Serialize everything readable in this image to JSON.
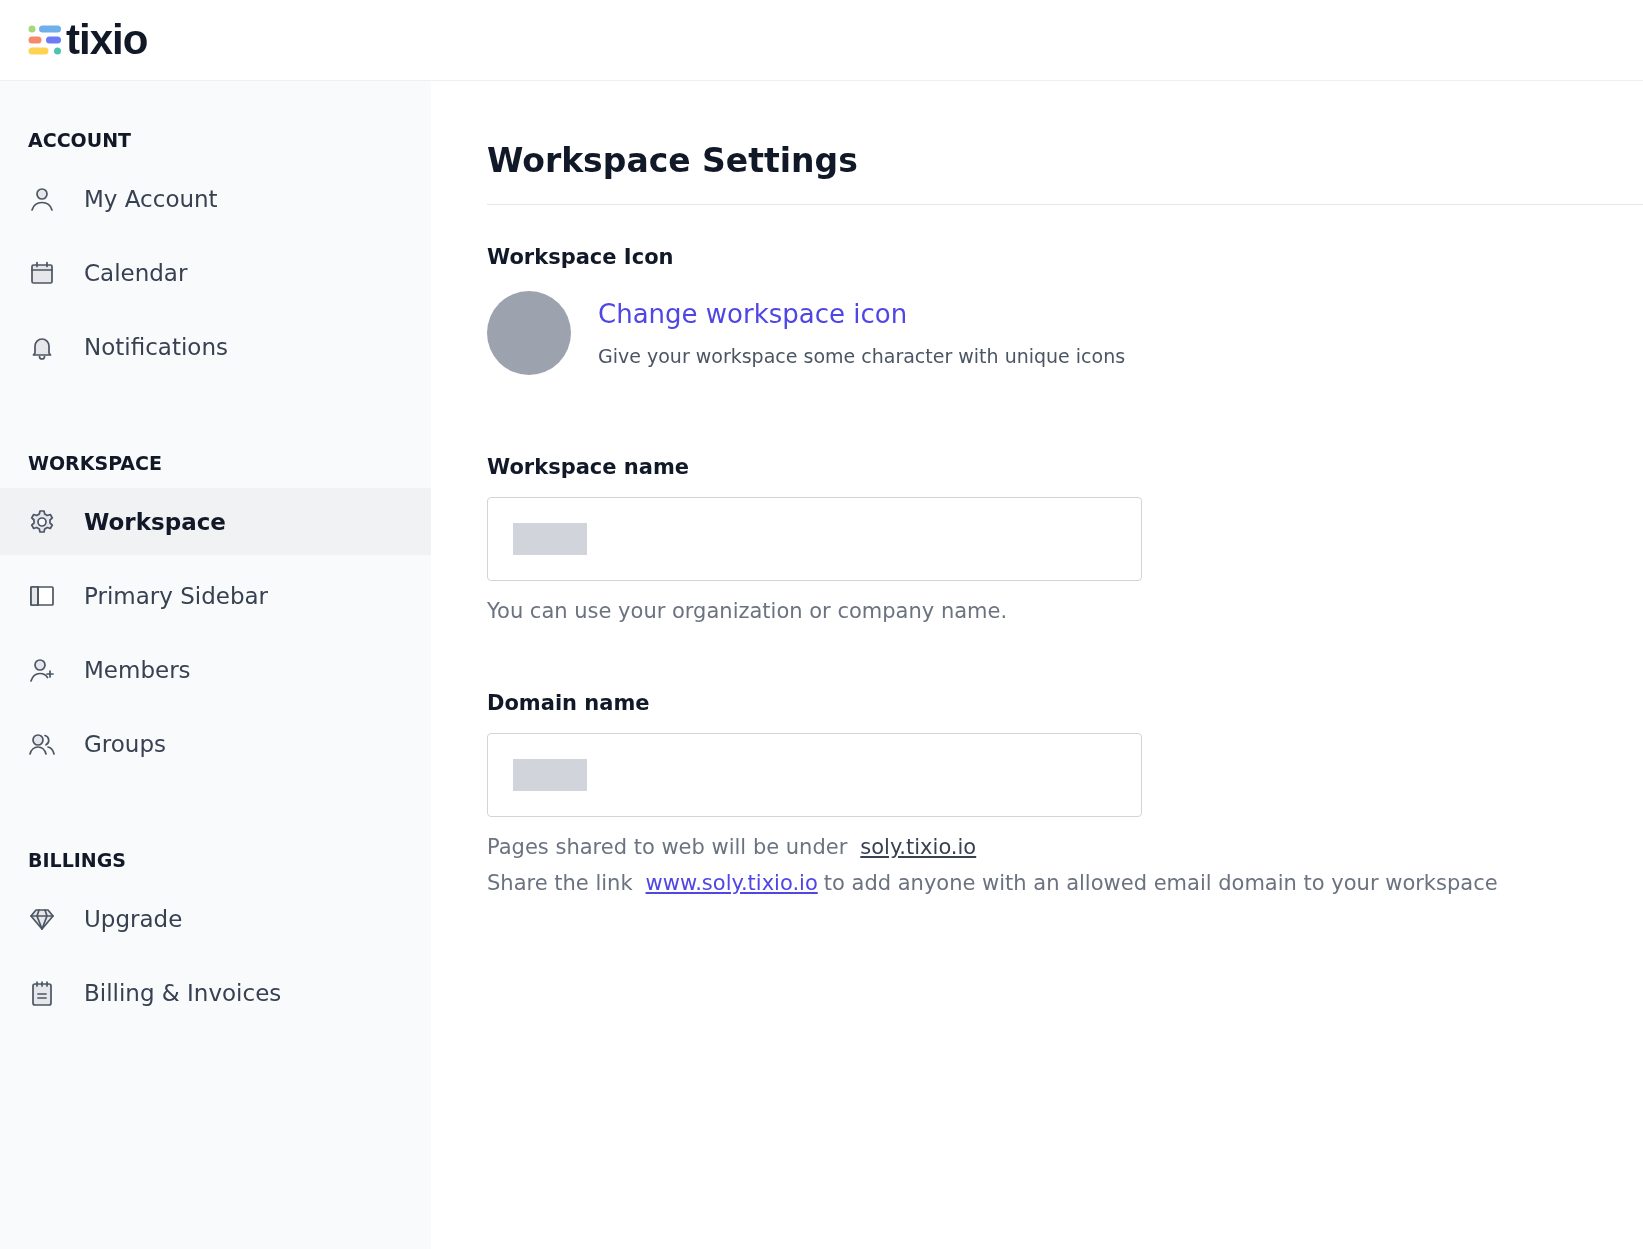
{
  "header": {
    "logo_text": "tixio"
  },
  "sidebar": {
    "sections": [
      {
        "title": "ACCOUNT",
        "items": [
          {
            "label": "My Account",
            "kind": "user",
            "selected": false
          },
          {
            "label": "Calendar",
            "kind": "calendar",
            "selected": false
          },
          {
            "label": "Notifications",
            "kind": "bell",
            "selected": false
          }
        ]
      },
      {
        "title": "WORKSPACE",
        "items": [
          {
            "label": "Workspace",
            "kind": "gear",
            "selected": true
          },
          {
            "label": "Primary Sidebar",
            "kind": "sidebar",
            "selected": false
          },
          {
            "label": "Members",
            "kind": "user-plus",
            "selected": false
          },
          {
            "label": "Groups",
            "kind": "users",
            "selected": false
          }
        ]
      },
      {
        "title": "BILLINGS",
        "items": [
          {
            "label": "Upgrade",
            "kind": "diamond",
            "selected": false
          },
          {
            "label": "Billing & Invoices",
            "kind": "clipboard",
            "selected": false
          }
        ]
      }
    ]
  },
  "main": {
    "title": "Workspace Settings",
    "icon_section": {
      "label": "Workspace Icon",
      "link": "Change workspace icon",
      "description": "Give your workspace some character with unique icons"
    },
    "fields": [
      {
        "label": "Workspace name",
        "redacted": true,
        "hints": [
          {
            "text": "You can use your organization or company name."
          }
        ]
      },
      {
        "label": "Domain name",
        "redacted": true,
        "hints": [
          {
            "text": "Pages shared to web will be under",
            "link": "soly.tixio.io"
          },
          {
            "text": "Share the link",
            "link": "www.soly.tixio.io",
            "after": "to add anyone with an allowed email domain to your workspace"
          }
        ]
      }
    ]
  }
}
